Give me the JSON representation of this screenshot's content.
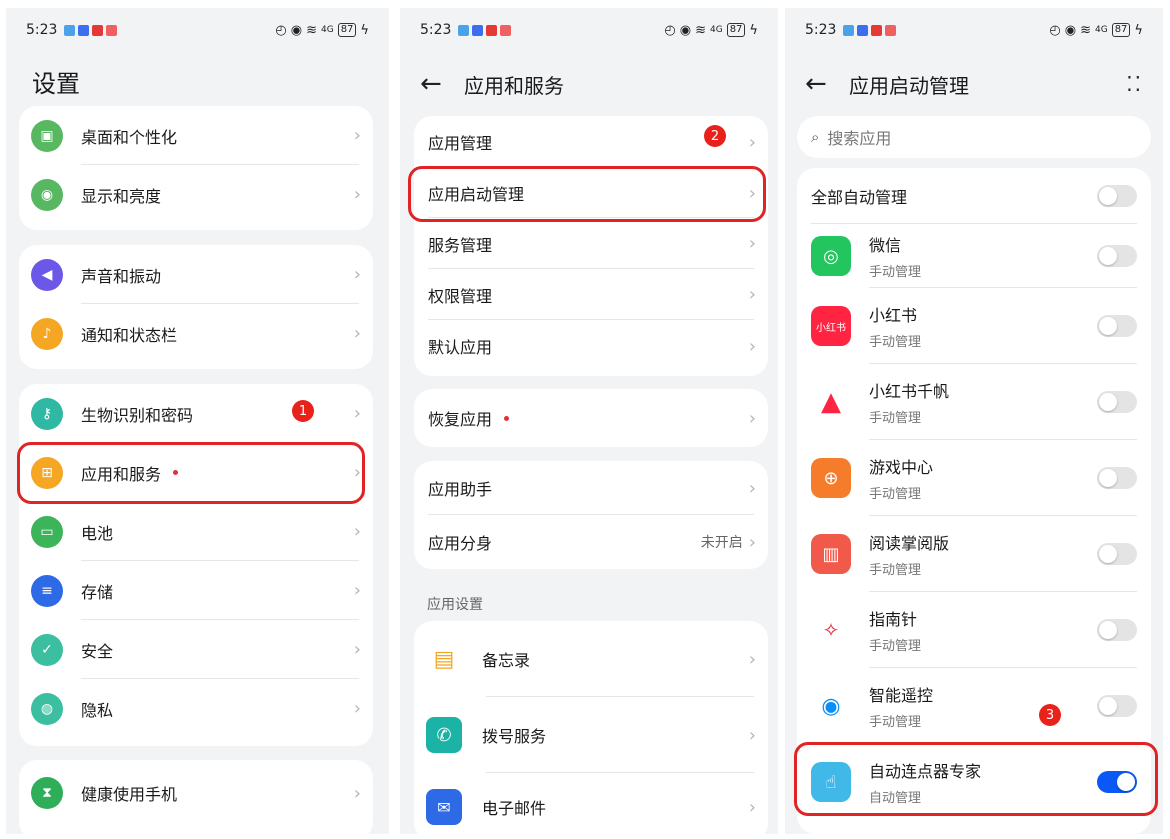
{
  "status": {
    "time": "5:23",
    "battery": "87",
    "signal": "4G"
  },
  "screen1": {
    "title": "设置",
    "group1": [
      "桌面和个性化",
      "显示和亮度"
    ],
    "group2": [
      "声音和振动",
      "通知和状态栏"
    ],
    "group3": [
      "生物识别和密码",
      "应用和服务",
      "电池",
      "存储",
      "安全",
      "隐私"
    ],
    "group4": [
      "健康使用手机"
    ],
    "badge": "1"
  },
  "screen2": {
    "title": "应用和服务",
    "group1": [
      "应用管理",
      "应用启动管理",
      "服务管理",
      "权限管理",
      "默认应用"
    ],
    "group2": [
      "恢复应用"
    ],
    "group3": [
      "应用助手",
      "应用分身"
    ],
    "clone_value": "未开启",
    "section_label": "应用设置",
    "group4": [
      "备忘录",
      "拨号服务",
      "电子邮件"
    ],
    "badge": "2"
  },
  "screen3": {
    "title": "应用启动管理",
    "search_placeholder": "搜索应用",
    "all_label": "全部自动管理",
    "apps": [
      {
        "name": "微信",
        "sub": "手动管理",
        "on": false
      },
      {
        "name": "小红书",
        "sub": "手动管理",
        "on": false
      },
      {
        "name": "小红书千帆",
        "sub": "手动管理",
        "on": false
      },
      {
        "name": "游戏中心",
        "sub": "手动管理",
        "on": false
      },
      {
        "name": "阅读掌阅版",
        "sub": "手动管理",
        "on": false
      },
      {
        "name": "指南针",
        "sub": "手动管理",
        "on": false
      },
      {
        "name": "智能遥控",
        "sub": "手动管理",
        "on": false
      },
      {
        "name": "自动连点器专家",
        "sub": "自动管理",
        "on": true
      }
    ],
    "xhs_icon_text": "小红书",
    "badge": "3"
  }
}
